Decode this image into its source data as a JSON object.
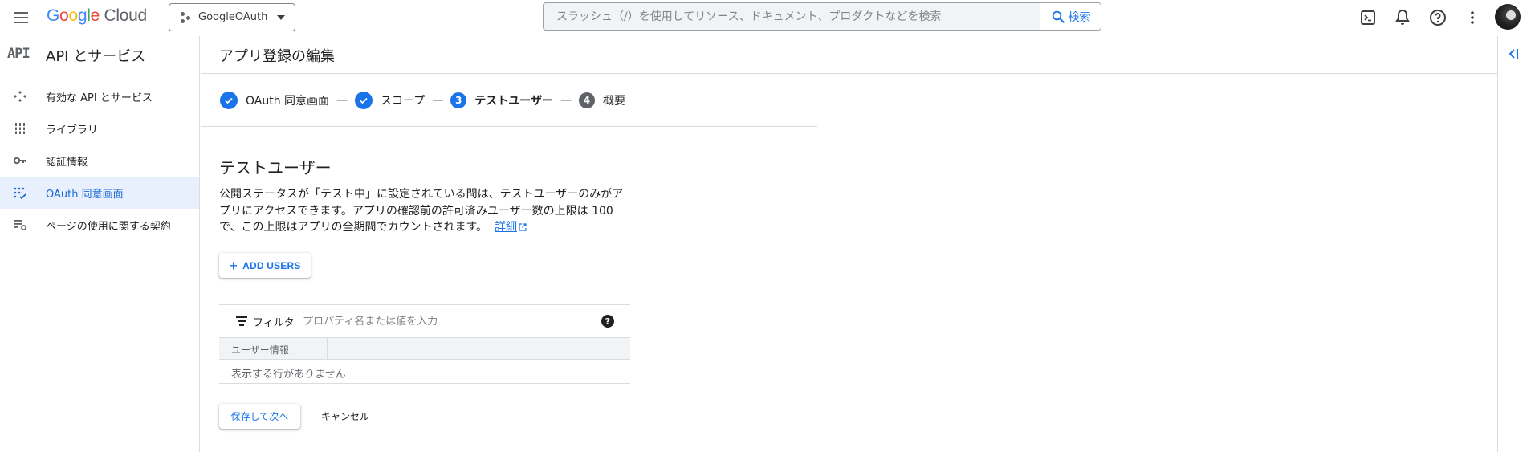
{
  "header": {
    "logo": {
      "g": "G",
      "o1": "o",
      "o2": "o",
      "g2": "g",
      "l": "l",
      "e": "e",
      "cloud": "Cloud"
    },
    "project": "GoogleOAuth",
    "search_placeholder": "スラッシュ（/）を使用してリソース、ドキュメント、プロダクトなどを検索",
    "search_button": "検索"
  },
  "sidebar": {
    "api_badge": "API",
    "title": "API とサービス",
    "items": [
      {
        "label": "有効な API とサービス",
        "icon": "enabled-apis-icon"
      },
      {
        "label": "ライブラリ",
        "icon": "library-icon"
      },
      {
        "label": "認証情報",
        "icon": "key-icon"
      },
      {
        "label": "OAuth 同意画面",
        "icon": "consent-icon",
        "active": true
      },
      {
        "label": "ページの使用に関する契約",
        "icon": "agreement-icon"
      }
    ]
  },
  "main": {
    "title": "アプリ登録の編集",
    "steps": [
      {
        "label": "OAuth 同意画面",
        "state": "done"
      },
      {
        "number": "3",
        "label": "テストユーザー",
        "state": "current"
      },
      {
        "number": "4",
        "label": "概要",
        "state": "todo"
      },
      {
        "label": "スコープ",
        "state": "done"
      }
    ],
    "step_separator": "—",
    "section_title": "テストユーザー",
    "description": "公開ステータスが「テスト中」に設定されている間は、テストユーザーのみがアプリにアクセスできます。アプリの確認前の許可済みユーザー数の上限は 100 で、この上限はアプリの全期間でカウントされます。",
    "learn_more": "詳細",
    "add_users": "ADD USERS",
    "filter": {
      "label": "フィルタ",
      "placeholder": "プロパティ名または値を入力",
      "help": "?"
    },
    "table": {
      "columns": [
        "ユーザー情報"
      ],
      "empty_message": "表示する行がありません"
    },
    "save_button": "保存して次へ",
    "cancel_button": "キャンセル"
  },
  "colors": {
    "accent": "#1a73e8",
    "active_bg": "#e8f0fe"
  }
}
